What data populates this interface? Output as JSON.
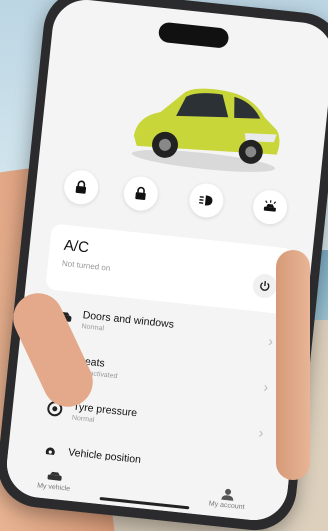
{
  "ac": {
    "title": "A/C",
    "status": "Not turned on"
  },
  "controls": [
    {
      "icon": "lock-icon"
    },
    {
      "icon": "lock-icon"
    },
    {
      "icon": "headlight-icon"
    },
    {
      "icon": "car-horn-icon"
    }
  ],
  "list": [
    {
      "icon": "car-door-icon",
      "label": "Doors and windows",
      "status": "Normal"
    },
    {
      "icon": "seat-icon",
      "label": "Seats",
      "status": "Not activated"
    },
    {
      "icon": "tyre-icon",
      "label": "Tyre pressure",
      "status": "Normal"
    },
    {
      "icon": "location-pin-icon",
      "label": "Vehicle position",
      "status": ""
    }
  ],
  "tabs": [
    {
      "icon": "car-icon",
      "label": "My vehicle"
    },
    {
      "icon": "user-icon",
      "label": "My account"
    }
  ],
  "colors": {
    "car_body": "#c8d63a",
    "screen_bg": "#f4f4f4",
    "phone_frame": "#2b2b2d"
  }
}
